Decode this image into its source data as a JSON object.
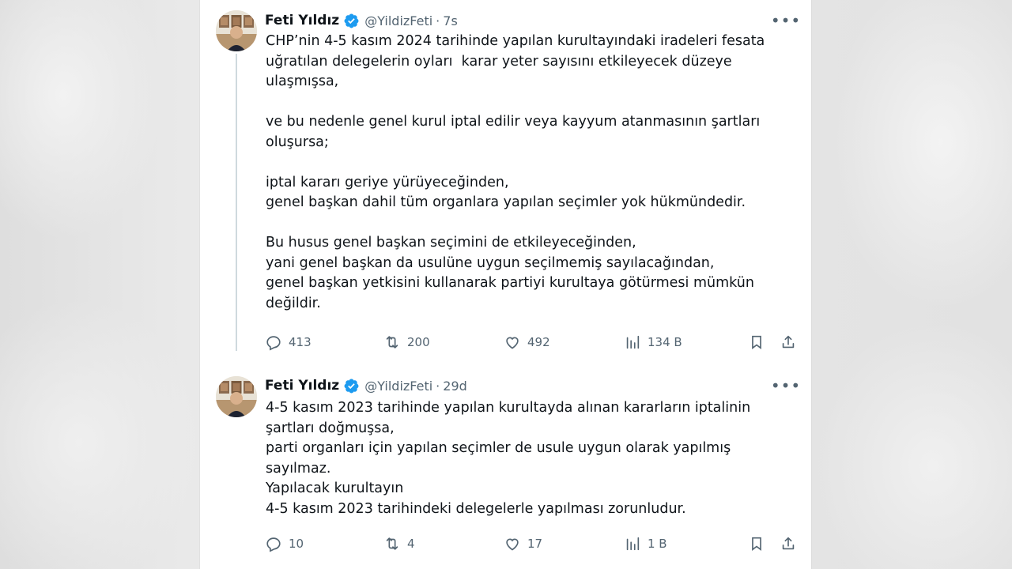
{
  "tweets": [
    {
      "author": {
        "name": "Feti Yıldız",
        "handle": "@YildizFeti",
        "time": "7s"
      },
      "text": "CHP’nin 4-5 kasım 2024 tarihinde yapılan kurultayındaki iradeleri fesata\nuğratılan delegelerin oyları  karar yeter sayısını etkileyecek düzeye\nulaşmışsa,\n\nve bu nedenle genel kurul iptal edilir veya kayyum atanmasının şartları\noluşursa;\n\niptal kararı geriye yürüyeceğinden,\ngenel başkan dahil tüm organlara yapılan seçimler yok hükmündedir.\n\nBu husus genel başkan seçimini de etkileyeceğinden,\nyani genel başkan da usulüne uygun seçilmemiş sayılacağından,\ngenel başkan yetkisini kullanarak partiyi kurultaya götürmesi mümkün\ndeğildir.",
      "stats": {
        "replies": "413",
        "retweets": "200",
        "likes": "492",
        "views": "134 B"
      }
    },
    {
      "author": {
        "name": "Feti Yıldız",
        "handle": "@YildizFeti",
        "time": "29d"
      },
      "text": "4-5 kasım 2023 tarihinde yapılan kurultayda alınan kararların iptalinin\nşartları doğmuşsa,\nparti organları için yapılan seçimler de usule uygun olarak yapılmış\nsayılmaz.\nYapılacak kurultayın\n4-5 kasım 2023 tarihindeki delegelerle yapılması zorunludur.",
      "stats": {
        "replies": "10",
        "retweets": "4",
        "likes": "17",
        "views": "1 B"
      }
    }
  ],
  "ui": {
    "separator": "·",
    "more_label": "•••"
  },
  "colors": {
    "verified_badge": "#1d9bf0",
    "text_primary": "#0f1419",
    "text_secondary": "#536471",
    "thread_line": "#cfd9de"
  },
  "icons": {
    "reply": "reply-icon",
    "retweet": "retweet-icon",
    "like": "heart-icon",
    "views": "views-icon",
    "bookmark": "bookmark-icon",
    "share": "share-icon",
    "verified": "verified-badge-icon",
    "more": "more-options-icon"
  }
}
